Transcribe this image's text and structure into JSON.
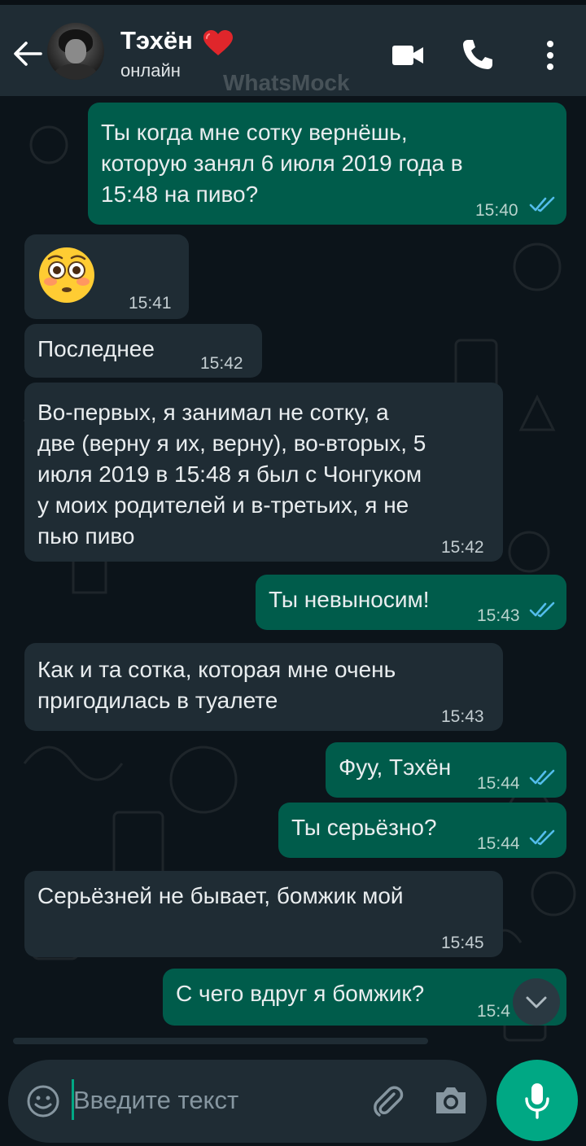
{
  "header": {
    "contact_name": "Тэхён",
    "status": "онлайн",
    "watermark": "WhatsMock",
    "icons": {
      "back": "arrow-left",
      "heart": "red-heart",
      "video": "video-camera",
      "call": "phone",
      "menu": "three-dots-vertical"
    }
  },
  "messages": [
    {
      "dir": "out",
      "text": "Ты когда мне сотку вернёшь,\nкоторую занял 6 июля 2019 года в\n15:48 на пиво?",
      "time": "15:40",
      "read": true
    },
    {
      "dir": "in",
      "emoji": "flushed-face",
      "text": "😳",
      "time": "15:41"
    },
    {
      "dir": "in",
      "text": "Последнее",
      "time": "15:42"
    },
    {
      "dir": "in",
      "text": "Во-первых, я занимал не сотку, а\nдве (верну я их, верну), во-вторых, 5\nиюля 2019 в 15:48 я был с Чонгуком\nу моих родителей и в-третьих, я не\nпью пиво",
      "time": "15:42"
    },
    {
      "dir": "out",
      "text": "Ты невыносим!",
      "time": "15:43",
      "read": true
    },
    {
      "dir": "in",
      "text": "Как и та сотка, которая мне очень\nпригодилась в туалете",
      "time": "15:43"
    },
    {
      "dir": "out",
      "text": "Фуу, Тэхён",
      "time": "15:44",
      "read": true
    },
    {
      "dir": "out",
      "text": "Ты серьёзно?",
      "time": "15:44",
      "read": true
    },
    {
      "dir": "in",
      "text": "Серьёзней не бывает, бомжик мой",
      "time": "15:45"
    },
    {
      "dir": "out",
      "text": "С чего вдруг я бомжик?",
      "time": "15:4",
      "read": true
    }
  ],
  "composer": {
    "placeholder": "Введите текст",
    "icons": {
      "emoji": "smile-icon",
      "attach": "paperclip",
      "camera": "camera",
      "mic": "microphone"
    }
  },
  "colors": {
    "background": "#0c141a",
    "header": "#1f2c34",
    "incoming": "#1f2c34",
    "outgoing": "#005c4b",
    "accent": "#00a884",
    "read_ticks": "#53bdeb"
  }
}
